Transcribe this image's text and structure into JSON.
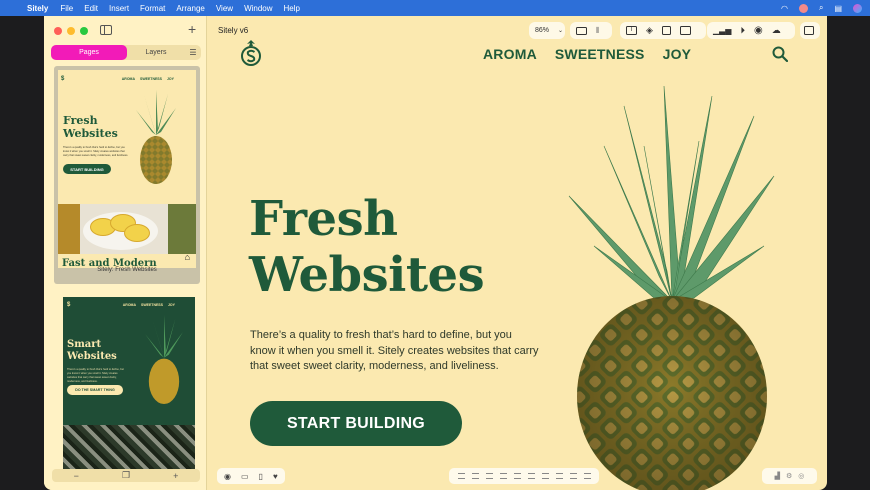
{
  "menubar": {
    "app": "Sitely",
    "items": [
      "File",
      "Edit",
      "Insert",
      "Format",
      "Arrange",
      "View",
      "Window",
      "Help"
    ]
  },
  "window": {
    "title": "Sitely v6",
    "zoom": "86%"
  },
  "sidebar": {
    "tabs": {
      "pages": "Pages",
      "layers": "Layers"
    },
    "thumbnails": [
      {
        "caption": "Sitely: Fresh Websites",
        "nav": [
          "AROMA",
          "SWEETNESS",
          "JOY"
        ],
        "title_line1": "Fresh",
        "title_line2": "Websites",
        "button": "START BUILDING",
        "footer_title": "Fast and Modern"
      },
      {
        "nav": [
          "AROMA",
          "SWEETNESS",
          "JOY"
        ],
        "title_line1": "Smart",
        "title_line2": "Websites",
        "button": "DO THE SMART THING"
      }
    ],
    "bottom": {
      "minus": "−",
      "plus": "+"
    }
  },
  "site": {
    "nav": [
      "AROMA",
      "SWEETNESS",
      "JOY"
    ],
    "hero_title_line1": "Fresh",
    "hero_title_line2": "Websites",
    "hero_body": "There’s a quality to fresh that’s hard to define, but you know it when you smell it. Sitely creates websites that carry that sweet sweet clarity, moderness, and liveliness.",
    "cta": "START BUILDING"
  },
  "colors": {
    "brand_green": "#1f5a3a",
    "canvas_bg": "#fbe9b0",
    "pages_tab": "#f21bb8",
    "menubar": "#2d6fd8"
  }
}
